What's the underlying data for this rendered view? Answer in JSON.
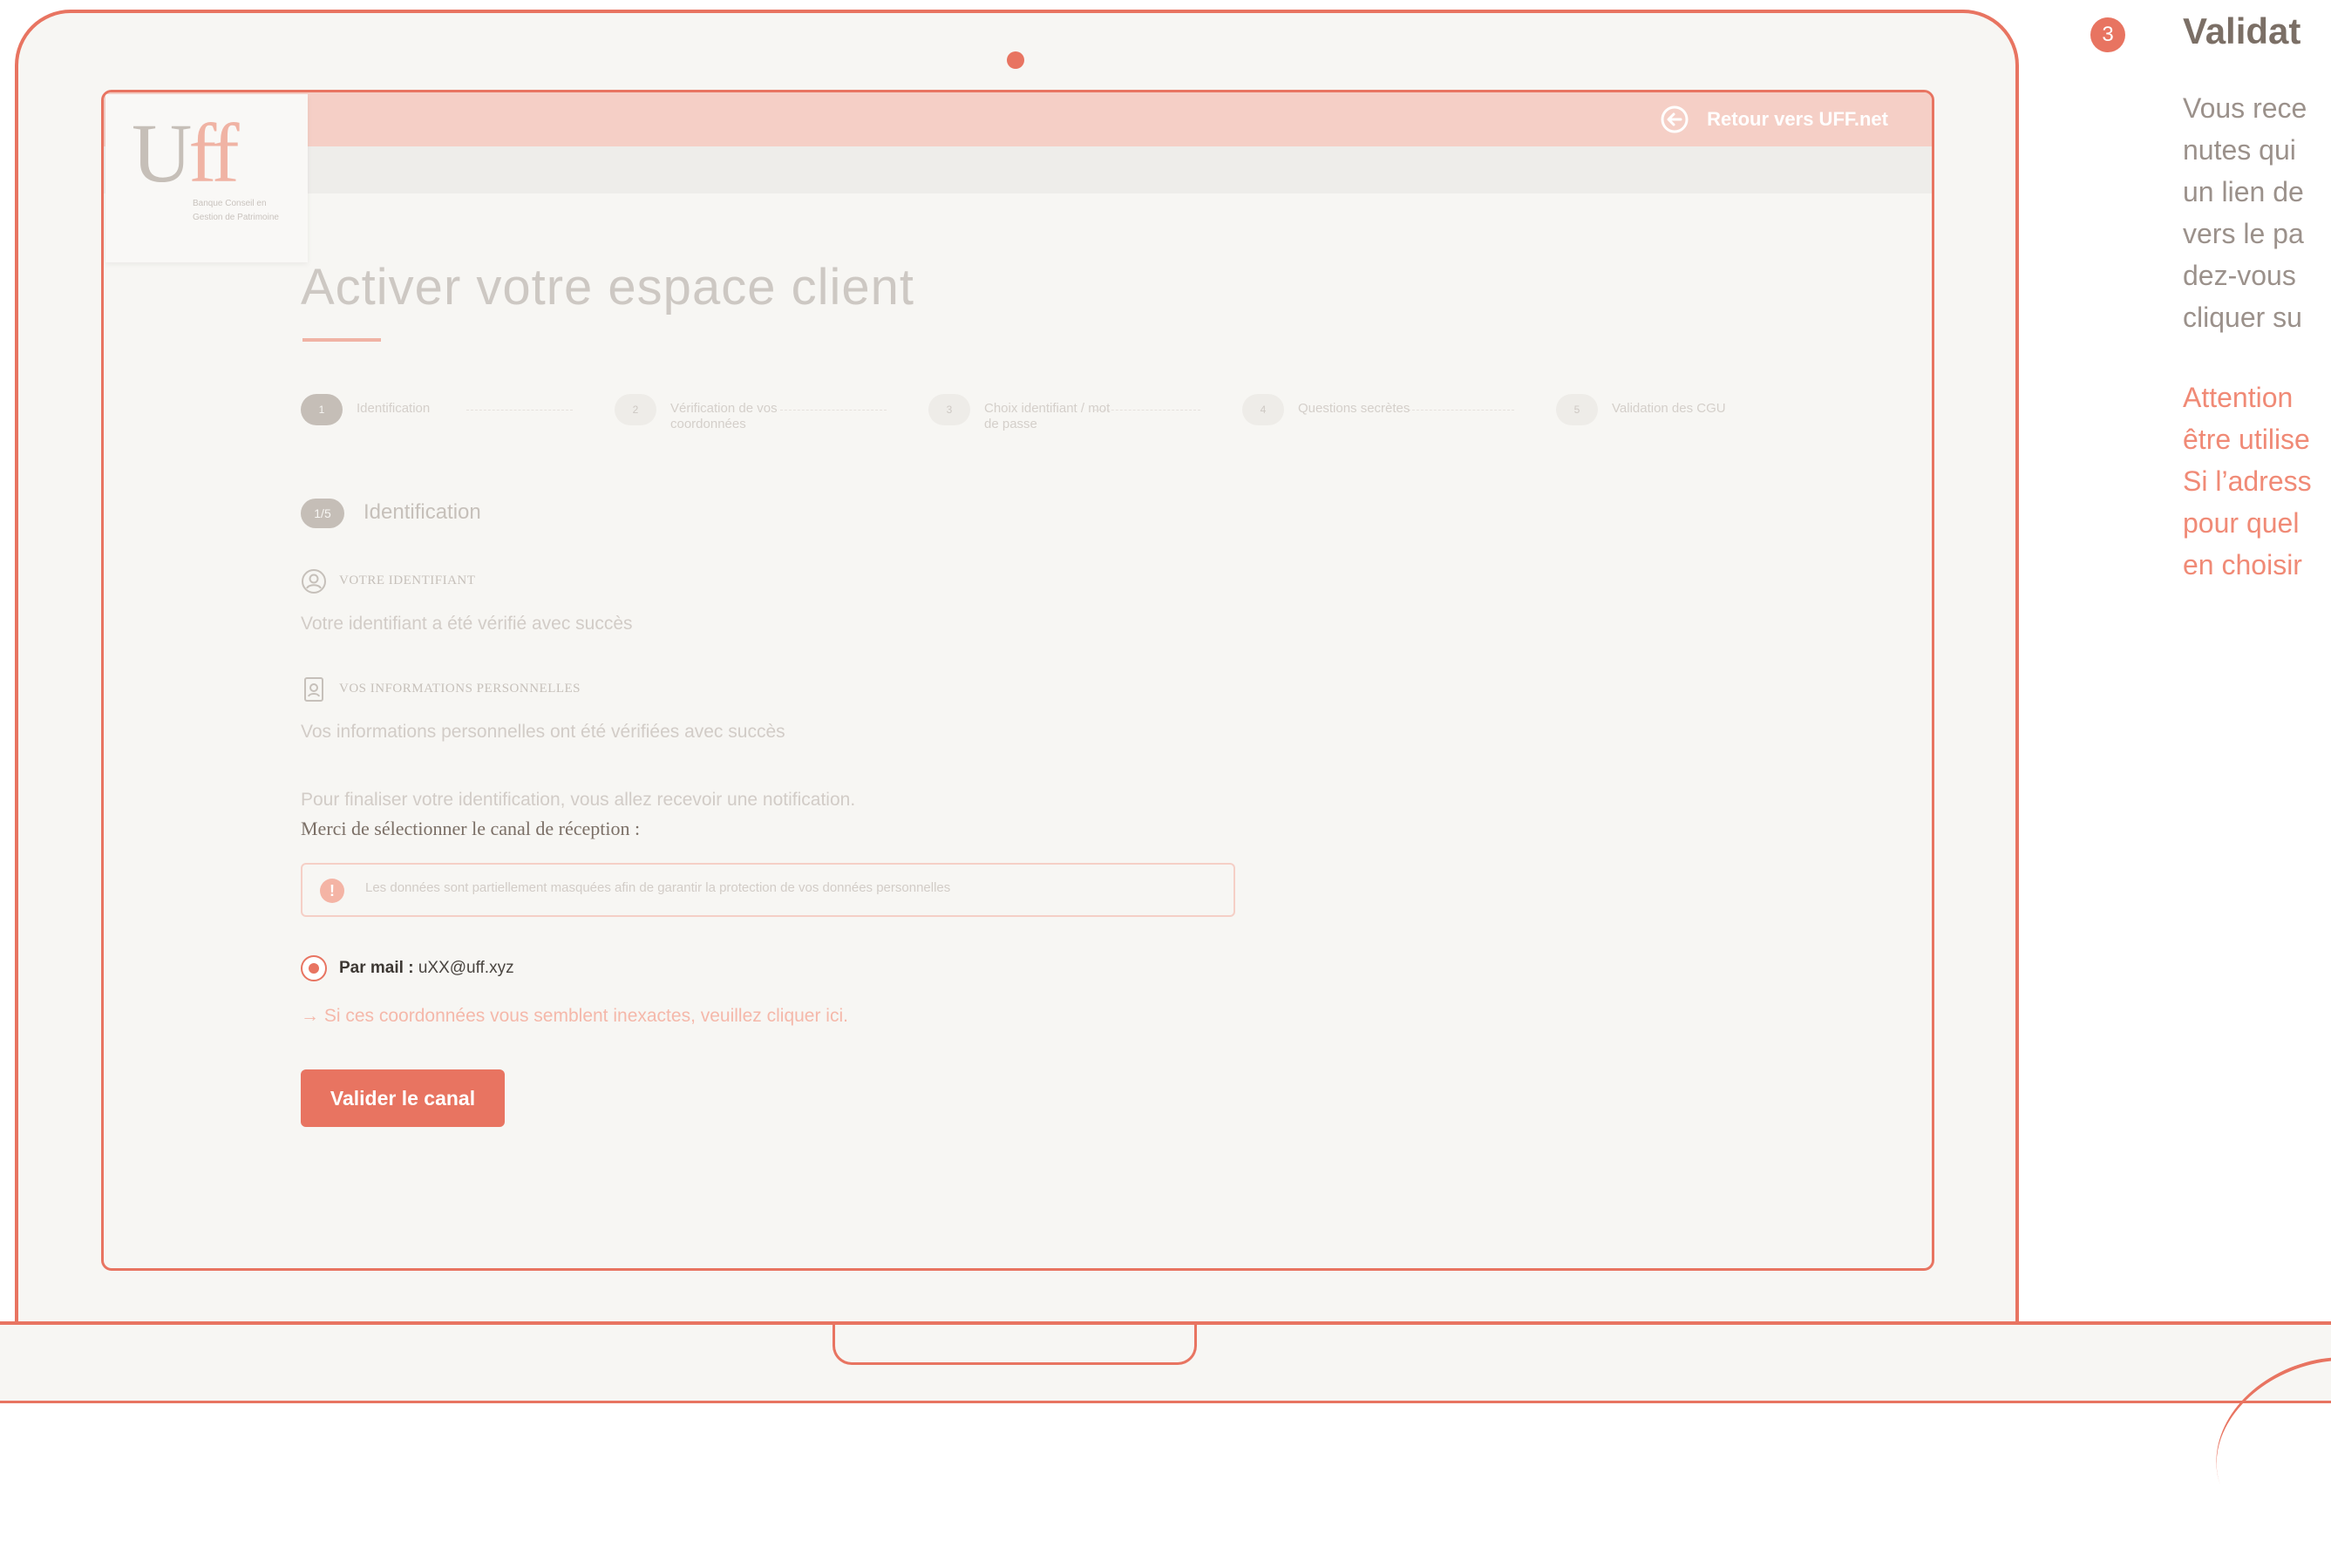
{
  "header": {
    "back_link_label": "Retour vers UFF.net"
  },
  "logo": {
    "letters_u": "U",
    "letters_ff": "ff",
    "tagline": "Banque Conseil en Gestion de Patrimoine"
  },
  "page": {
    "title": "Activer votre espace client"
  },
  "stepper": {
    "steps": [
      {
        "number": "1",
        "label": "Identification"
      },
      {
        "number": "2",
        "label": "Vérification de vos coordonnées"
      },
      {
        "number": "3",
        "label": "Choix identifiant / mot de passe"
      },
      {
        "number": "4",
        "label": "Questions secrètes"
      },
      {
        "number": "5",
        "label": "Validation des CGU"
      }
    ]
  },
  "section": {
    "badge": "1/5",
    "title": "Identification",
    "identifier_heading": "VOTRE IDENTIFIANT",
    "identifier_text": "Votre identifiant a été vérifié avec succès",
    "personal_heading": "VOS INFORMATIONS PERSONNELLES",
    "personal_text": "Vos informations personnelles ont été vérifiées avec succès",
    "intro_text": "Pour finaliser votre identification, vous allez recevoir une notification.",
    "intro_strong": "Merci de sélectionner le canal de réception :",
    "notice_text": "Les données sont partiellement masquées afin de garantir la protection de vos données personnelles",
    "radio_label": "Par mail :",
    "radio_value": "uXX@uff.xyz",
    "fix_link": "→ Si ces coordonnées vous semblent inexactes, veuillez cliquer ici.",
    "validate_button": "Valider le canal"
  },
  "panel": {
    "step_number": "3",
    "heading": "Validat",
    "body_lines": [
      "Vous rece",
      "nutes qui",
      "un lien de",
      "vers le pa",
      "dez-vous",
      "cliquer su"
    ],
    "warning_lines": [
      "Attention",
      "être utilise",
      "Si l’adress",
      "pour quel",
      "en choisir"
    ]
  },
  "colors": {
    "accent": "#e87461",
    "topbar": "#f5cfc6",
    "panel_text": "#9b918b",
    "heading_text": "#7b6f66"
  }
}
